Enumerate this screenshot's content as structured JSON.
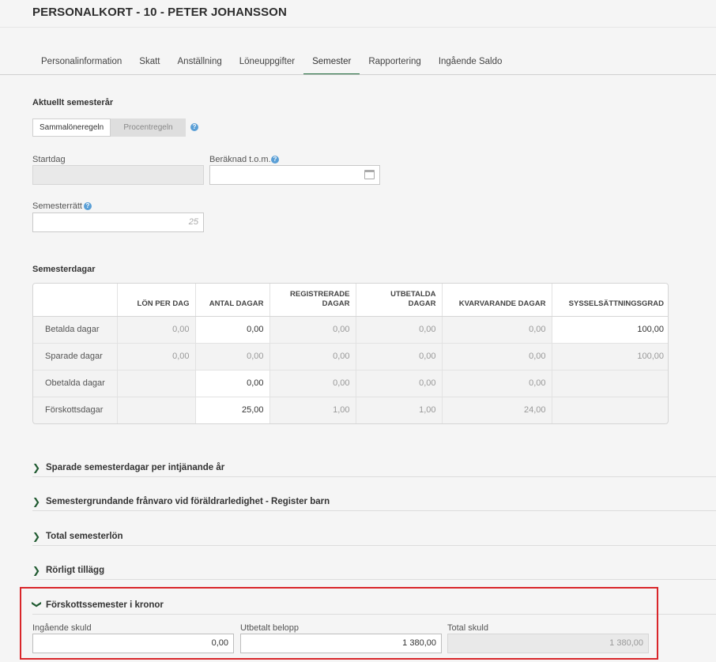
{
  "header": {
    "title": "PERSONALKORT - 10 - PETER JOHANSSON"
  },
  "tabs": [
    {
      "label": "Personalinformation",
      "active": false
    },
    {
      "label": "Skatt",
      "active": false
    },
    {
      "label": "Anställning",
      "active": false
    },
    {
      "label": "Löneuppgifter",
      "active": false
    },
    {
      "label": "Semester",
      "active": true
    },
    {
      "label": "Rapportering",
      "active": false
    },
    {
      "label": "Ingående Saldo",
      "active": false
    }
  ],
  "current_year": {
    "heading": "Aktuellt semesterår",
    "rule_options": {
      "selected": "Sammalöneregeln",
      "other": "Procentregeln"
    },
    "startdag": {
      "label": "Startdag",
      "value": ""
    },
    "beraknad": {
      "label": "Beräknad t.o.m.",
      "value": ""
    },
    "semesterratt": {
      "label": "Semesterrätt",
      "placeholder": "25"
    }
  },
  "semesterdagar": {
    "heading": "Semesterdagar",
    "columns": [
      "",
      "LÖN PER DAG",
      "ANTAL DAGAR",
      "REGISTRERADE DAGAR",
      "UTBETALDA DAGAR",
      "KVARVARANDE DAGAR",
      "SYSSELSÄTTNINGSGRAD"
    ],
    "rows": [
      {
        "label": "Betalda dagar",
        "lon": "0,00",
        "antal": "0,00",
        "registrerade": "0,00",
        "utbetalda": "0,00",
        "kvarvarande": "0,00",
        "grad": "100,00"
      },
      {
        "label": "Sparade dagar",
        "lon": "0,00",
        "antal": "0,00",
        "registrerade": "0,00",
        "utbetalda": "0,00",
        "kvarvarande": "0,00",
        "grad": "100,00"
      },
      {
        "label": "Obetalda dagar",
        "lon": "",
        "antal": "0,00",
        "registrerade": "0,00",
        "utbetalda": "0,00",
        "kvarvarande": "0,00",
        "grad": ""
      },
      {
        "label": "Förskottsdagar",
        "lon": "",
        "antal": "25,00",
        "registrerade": "1,00",
        "utbetalda": "1,00",
        "kvarvarande": "24,00",
        "grad": ""
      }
    ]
  },
  "accordions": [
    {
      "label": "Sparade semesterdagar per intjänande år"
    },
    {
      "label": "Semestergrundande frånvaro vid föräldrarledighet - Register barn"
    },
    {
      "label": "Total semesterlön"
    },
    {
      "label": "Rörligt tillägg"
    },
    {
      "label": "Förskottssemester i kronor"
    }
  ],
  "forskott": {
    "ingaende": {
      "label": "Ingående skuld",
      "value": "0,00"
    },
    "utbetalt": {
      "label": "Utbetalt belopp",
      "value": "1 380,00"
    },
    "total": {
      "label": "Total skuld",
      "value": "1 380,00"
    }
  },
  "colors": {
    "accent": "#1f6b3a",
    "help": "#5a9fd6",
    "highlight": "#d9262a"
  },
  "icons": {
    "chevron_right": "chevron-right-icon",
    "chevron_down": "chevron-down-icon",
    "calendar": "calendar-icon",
    "help": "help-icon"
  }
}
